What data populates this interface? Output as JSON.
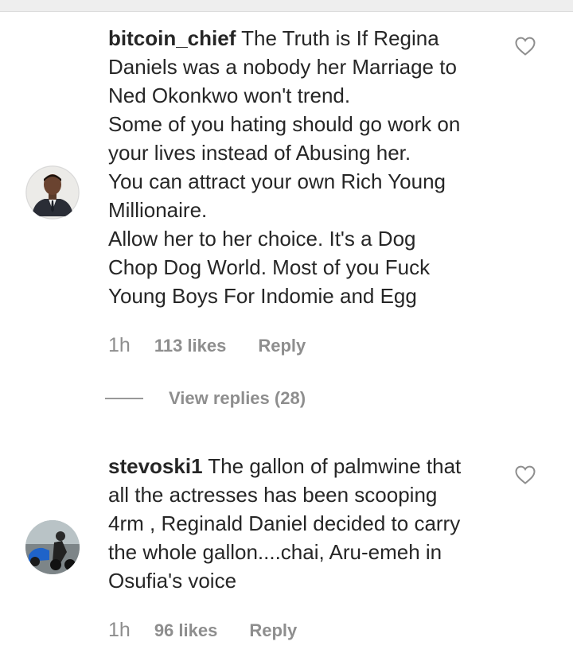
{
  "comments": [
    {
      "username": "bitcoin_chief",
      "lines": [
        "The Truth is If Regina",
        "Daniels was a nobody her Marriage to",
        "Ned Okonkwo won't trend.",
        "Some of you hating should go work on",
        "your lives instead of Abusing her.",
        "You can attract your own Rich Young",
        "Millionaire.",
        "Allow her to her choice. It's a Dog",
        "Chop Dog World. Most of you Fuck",
        "Young Boys For Indomie and Egg"
      ],
      "time": "1h",
      "likes": "113 likes",
      "reply": "Reply",
      "view_replies": "View replies (28)",
      "avatar_icon": "avatar-man-in-suit",
      "like_icon": "heart-outline-icon"
    },
    {
      "username": "stevoski1",
      "lines": [
        "The gallon of palmwine that",
        "all the actresses has been scooping",
        "4rm , Reginald Daniel decided to carry",
        "the whole gallon....chai, Aru-emeh in",
        "Osufia's voice"
      ],
      "time": "1h",
      "likes": "96 likes",
      "reply": "Reply",
      "avatar_icon": "avatar-motorbike",
      "like_icon": "heart-outline-icon"
    }
  ],
  "colors": {
    "text": "#262626",
    "meta": "#8e8e8e",
    "background": "#ffffff"
  }
}
